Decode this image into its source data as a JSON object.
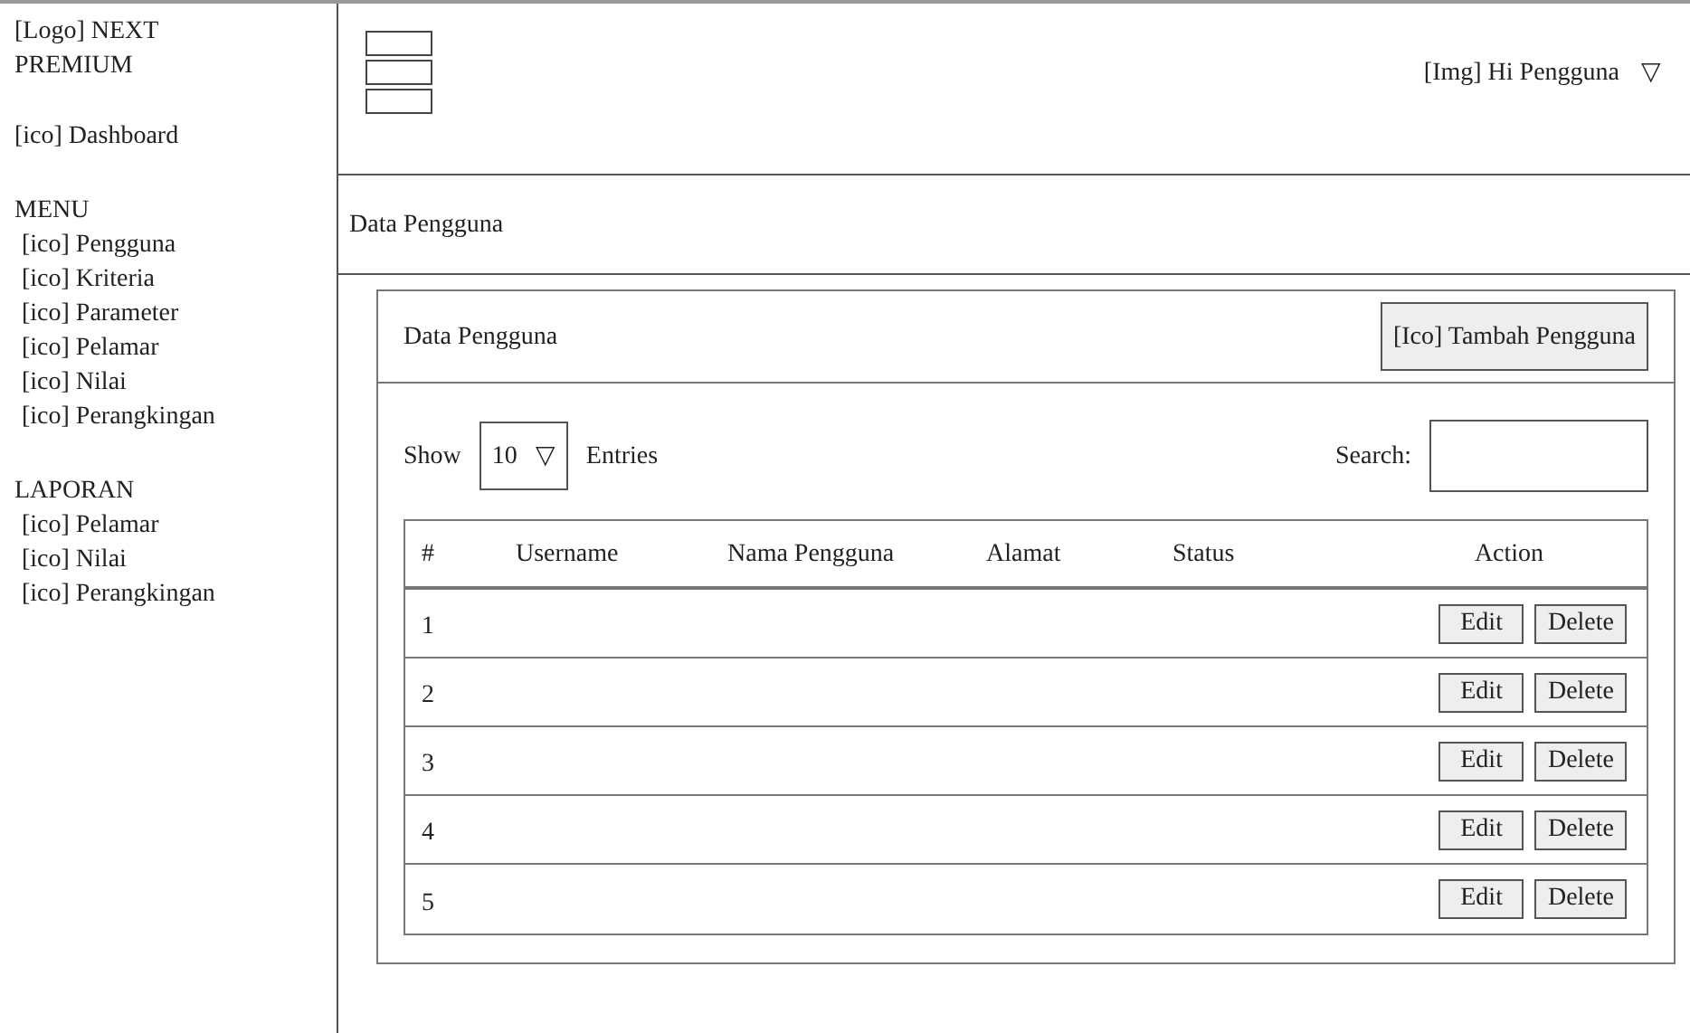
{
  "brand": "[Logo] NEXT PREMIUM",
  "sidebar": {
    "top_item": "[ico] Dashboard",
    "sections": [
      {
        "title": "MENU",
        "items": [
          "[ico] Pengguna",
          "[ico] Kriteria",
          "[ico] Parameter",
          "[ico] Pelamar",
          "[ico] Nilai",
          "[ico] Perangkingan"
        ]
      },
      {
        "title": "LAPORAN",
        "items": [
          "[ico] Pelamar",
          "[ico] Nilai",
          "[ico] Perangkingan"
        ]
      }
    ]
  },
  "header": {
    "user": "[Img] Hi Pengguna",
    "dropdown_caret": "▽"
  },
  "breadcrumb": "Data Pengguna",
  "card": {
    "title": "Data Pengguna",
    "add_button": "[Ico] Tambah Pengguna",
    "show_label": "Show",
    "entries_select": {
      "value": "10",
      "caret": "▽"
    },
    "entries_label": "Entries",
    "search_label": "Search:"
  },
  "table": {
    "columns": [
      "#",
      "Username",
      "Nama Pengguna",
      "Alamat",
      "Status",
      "Action"
    ],
    "rows": [
      {
        "number": "1",
        "edit": "Edit",
        "delete": "Delete"
      },
      {
        "number": "2",
        "edit": "Edit",
        "delete": "Delete"
      },
      {
        "number": "3",
        "edit": "Edit",
        "delete": "Delete"
      },
      {
        "number": "4",
        "edit": "Edit",
        "delete": "Delete"
      },
      {
        "number": "5",
        "edit": "Edit",
        "delete": "Delete"
      }
    ]
  }
}
